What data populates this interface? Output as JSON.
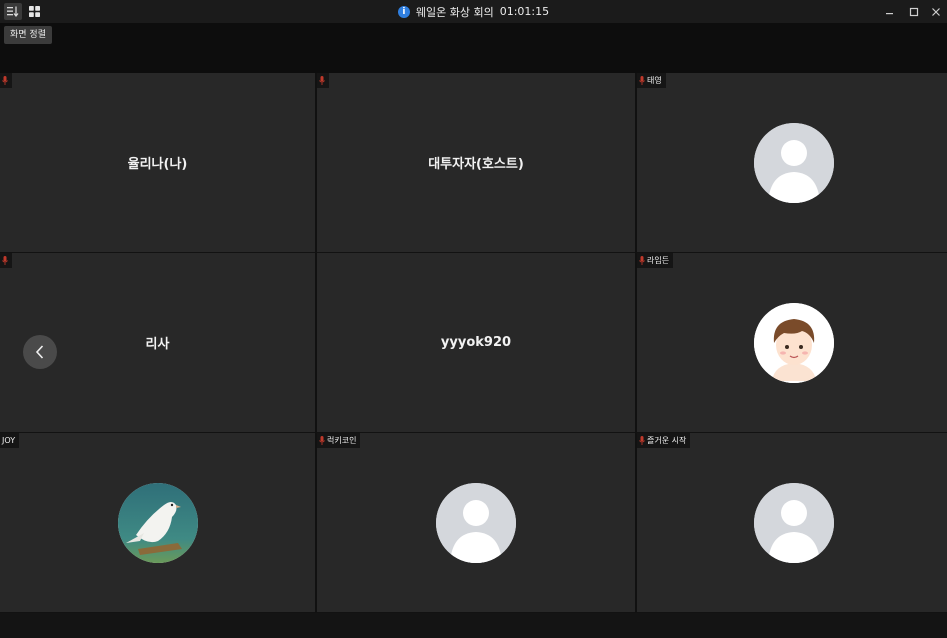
{
  "titlebar": {
    "title": "웨일온 화상 회의",
    "timer": "01:01:15",
    "icons": [
      "sort-icon",
      "grid-view-icon",
      "info-icon",
      "minimize-icon",
      "maximize-icon",
      "close-icon"
    ]
  },
  "tooltip": {
    "text": "화면 정렬"
  },
  "tiles": [
    {
      "id": "t1",
      "center_name": "율리나(나)",
      "tag": "",
      "muted": true
    },
    {
      "id": "t2",
      "center_name": "대투자자(호스트)",
      "tag": "",
      "muted": true
    },
    {
      "id": "t3",
      "tag": "태영",
      "muted": true,
      "avatar": "default-avatar"
    },
    {
      "id": "t4",
      "center_name": "리사",
      "tag": "",
      "muted": true
    },
    {
      "id": "t5",
      "center_name": "yyyok920",
      "tag": ""
    },
    {
      "id": "t6",
      "tag": "라임든",
      "muted": true,
      "avatar": "cartoon-boy-avatar"
    },
    {
      "id": "t7",
      "tag": "JOY",
      "avatar": "white-bird-avatar"
    },
    {
      "id": "t8",
      "tag": "럭키코인",
      "muted": true,
      "avatar": "default-avatar"
    },
    {
      "id": "t9",
      "tag": "즐거운 시작",
      "muted": true,
      "avatar": "default-avatar"
    }
  ],
  "colors": {
    "tile_bg": "#282828",
    "muted_mic": "#c0392b",
    "info": "#2f7fe0"
  }
}
